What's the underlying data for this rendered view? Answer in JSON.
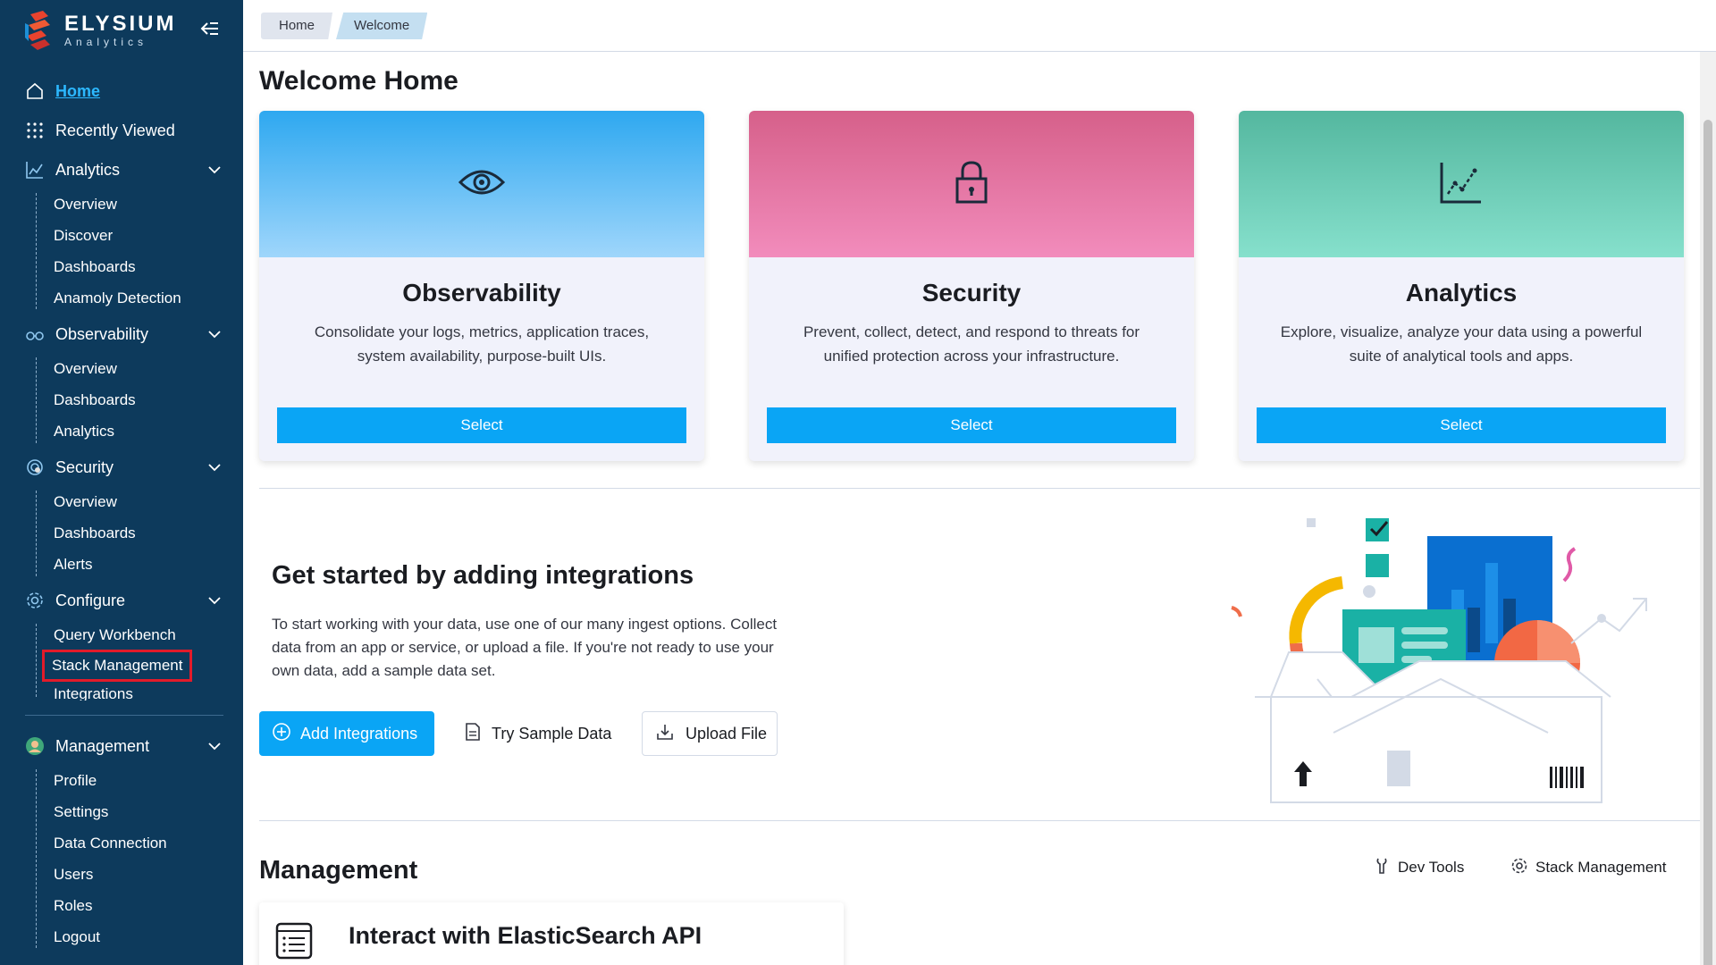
{
  "brand": {
    "title": "ELYSIUM",
    "subtitle": "Analytics"
  },
  "sidebar": {
    "home": "Home",
    "recently_viewed": "Recently Viewed",
    "analytics": {
      "label": "Analytics",
      "items": [
        "Overview",
        "Discover",
        "Dashboards",
        "Anamoly Detection"
      ]
    },
    "observability": {
      "label": "Observability",
      "items": [
        "Overview",
        "Dashboards",
        "Analytics"
      ]
    },
    "security": {
      "label": "Security",
      "items": [
        "Overview",
        "Dashboards",
        "Alerts"
      ]
    },
    "configure": {
      "label": "Configure",
      "items": [
        "Query Workbench",
        "Stack Management",
        "Integrations"
      ]
    },
    "management": {
      "label": "Management",
      "items": [
        "Profile",
        "Settings",
        "Data Connection",
        "Users",
        "Roles",
        "Logout"
      ]
    }
  },
  "breadcrumbs": [
    "Home",
    "Welcome"
  ],
  "page_title": "Welcome Home",
  "cards": [
    {
      "title": "Observability",
      "description": "Consolidate your logs, metrics, application traces, system availability, purpose-built UIs.",
      "button": "Select",
      "icon": "eye-icon",
      "colors": [
        "#2ea8f0",
        "#9fd6fb"
      ]
    },
    {
      "title": "Security",
      "description": "Prevent, collect, detect, and respond to threats for unified protection across your infrastructure.",
      "button": "Select",
      "icon": "lock-icon",
      "colors": [
        "#d6608a",
        "#f28cbc"
      ]
    },
    {
      "title": "Analytics",
      "description": "Explore, visualize, analyze your data using a powerful suite of analytical tools and apps.",
      "button": "Select",
      "icon": "chart-icon",
      "colors": [
        "#54b79f",
        "#86e0cc"
      ]
    }
  ],
  "integrations": {
    "title": "Get started by adding integrations",
    "description": "To start working with your data, use one of our many ingest options. Collect data from an app or service, or upload a file. If you're not ready to use your own data, add a sample data set.",
    "add_button": "Add Integrations",
    "sample_button": "Try Sample Data",
    "upload_button": "Upload File"
  },
  "management": {
    "title": "Management",
    "dev_tools": "Dev Tools",
    "stack_management": "Stack Management",
    "api_card_title": "Interact with ElasticSearch API"
  },
  "colors": {
    "sidebar": "#0d3a5c",
    "accent": "#0aa5f5",
    "active_link": "#2cb8ff",
    "highlight": "#e21b2a"
  }
}
